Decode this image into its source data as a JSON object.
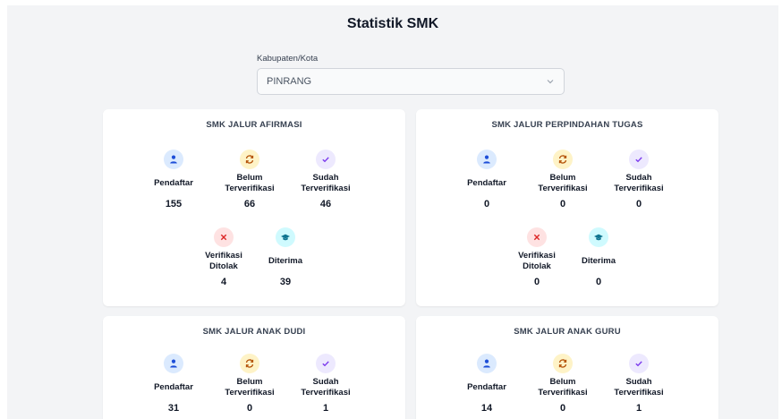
{
  "page": {
    "title": "Statistik SMK"
  },
  "filter": {
    "label": "Kabupaten/Kota",
    "selected": "PINRANG"
  },
  "cards": [
    {
      "title": "SMK JALUR AFIRMASI",
      "pendaftar": {
        "label": "Pendaftar",
        "value": "155"
      },
      "belum": {
        "label1": "Belum",
        "label2": "Terverifikasi",
        "value": "66"
      },
      "sudah": {
        "label1": "Sudah",
        "label2": "Terverifikasi",
        "value": "46"
      },
      "ditolak": {
        "label1": "Verifikasi",
        "label2": "Ditolak",
        "value": "4"
      },
      "diterima": {
        "label": "Diterima",
        "value": "39"
      }
    },
    {
      "title": "SMK JALUR PERPINDAHAN TUGAS",
      "pendaftar": {
        "label": "Pendaftar",
        "value": "0"
      },
      "belum": {
        "label1": "Belum",
        "label2": "Terverifikasi",
        "value": "0"
      },
      "sudah": {
        "label1": "Sudah",
        "label2": "Terverifikasi",
        "value": "0"
      },
      "ditolak": {
        "label1": "Verifikasi",
        "label2": "Ditolak",
        "value": "0"
      },
      "diterima": {
        "label": "Diterima",
        "value": "0"
      }
    },
    {
      "title": "SMK JALUR ANAK DUDI",
      "pendaftar": {
        "label": "Pendaftar",
        "value": "31"
      },
      "belum": {
        "label1": "Belum",
        "label2": "Terverifikasi",
        "value": "0"
      },
      "sudah": {
        "label1": "Sudah",
        "label2": "Terverifikasi",
        "value": "1"
      }
    },
    {
      "title": "SMK JALUR ANAK GURU",
      "pendaftar": {
        "label": "Pendaftar",
        "value": "14"
      },
      "belum": {
        "label1": "Belum",
        "label2": "Terverifikasi",
        "value": "0"
      },
      "sudah": {
        "label1": "Sudah",
        "label2": "Terverifikasi",
        "value": "1"
      }
    }
  ],
  "icons": {
    "pendaftar": "user-icon",
    "belum": "refresh-icon",
    "sudah": "check-icon",
    "ditolak": "x-icon",
    "diterima": "graduation-cap-icon"
  },
  "colors": {
    "user": "#1d4ed8",
    "pending": "#b45309",
    "verified": "#7c3aed",
    "rejected": "#dc2626",
    "accepted": "#0e7490"
  }
}
